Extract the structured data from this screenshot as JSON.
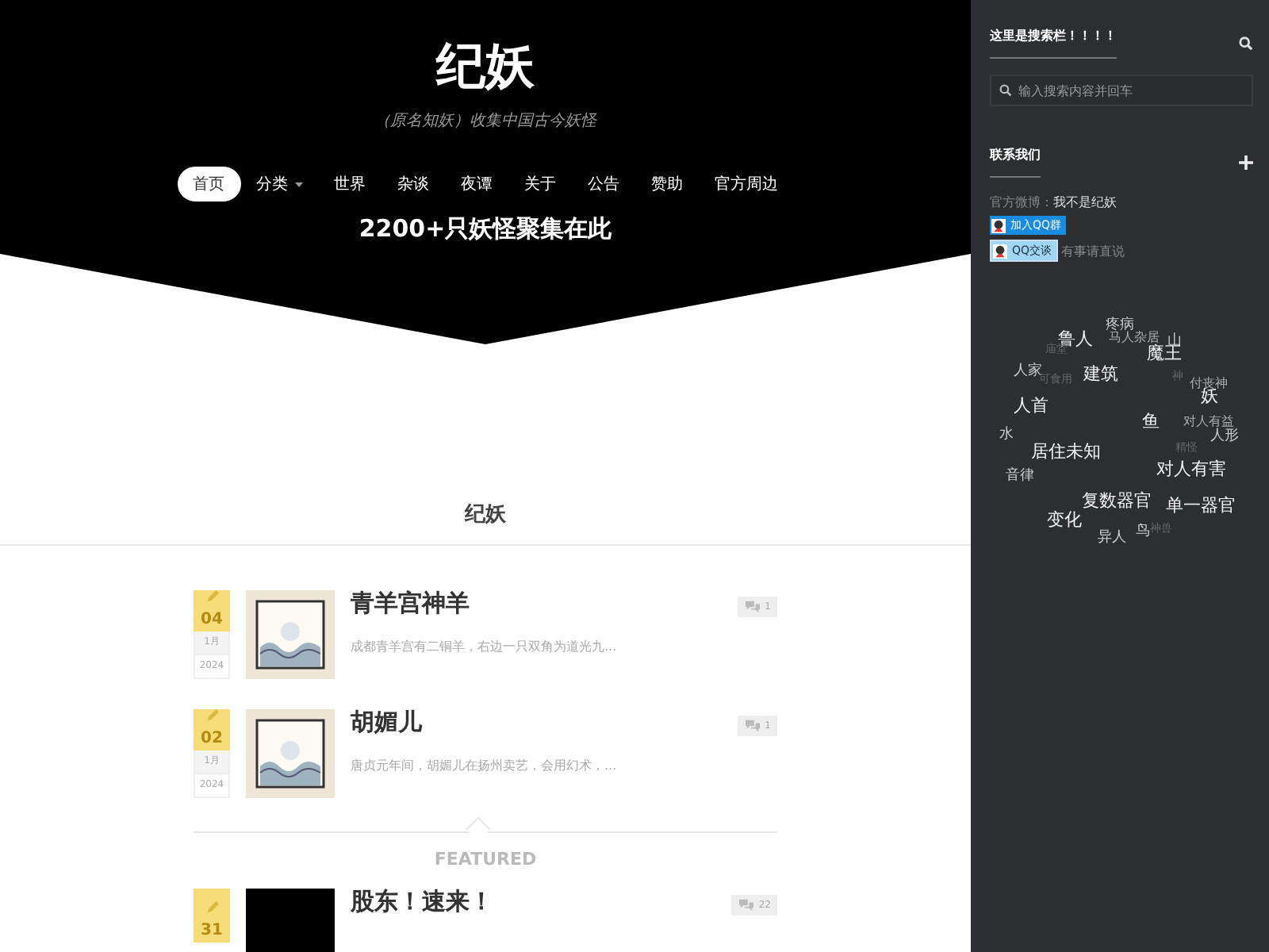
{
  "site": {
    "title": "纪妖",
    "tagline": "（原名知妖）收集中国古今妖怪",
    "banner": "2200+只妖怪聚集在此"
  },
  "nav": [
    {
      "label": "首页",
      "selected": true,
      "dropdown": false
    },
    {
      "label": "分类",
      "selected": false,
      "dropdown": true
    },
    {
      "label": "世界",
      "selected": false,
      "dropdown": false
    },
    {
      "label": "杂谈",
      "selected": false,
      "dropdown": false
    },
    {
      "label": "夜谭",
      "selected": false,
      "dropdown": false
    },
    {
      "label": "关于",
      "selected": false,
      "dropdown": false
    },
    {
      "label": "公告",
      "selected": false,
      "dropdown": false
    },
    {
      "label": "赞助",
      "selected": false,
      "dropdown": false
    },
    {
      "label": "官方周边",
      "selected": false,
      "dropdown": false
    }
  ],
  "section_title": "纪妖",
  "posts": [
    {
      "day": "04",
      "month": "1月",
      "year": "2024",
      "kind": "stamp",
      "title": "青羊宫神羊",
      "excerpt": "成都青羊宫有二铜羊，右边一只双角为道光九...",
      "comments": "1"
    },
    {
      "day": "02",
      "month": "1月",
      "year": "2024",
      "kind": "stamp",
      "title": "胡媚儿",
      "excerpt": "唐贞元年间，胡媚儿在扬州卖艺，会用幻术，...",
      "comments": "1"
    }
  ],
  "featured": {
    "label": "FEATURED",
    "posts": [
      {
        "day": "31",
        "kind": "dark",
        "title": "股东！速来！",
        "comments": "22"
      }
    ]
  },
  "sidebar": {
    "search": {
      "title": "这里是搜索栏！！！！",
      "placeholder": "输入搜索内容并回车"
    },
    "contact": {
      "title": "联系我们",
      "weibo_label": "官方微博：",
      "weibo_link": "我不是纪妖",
      "qq_group": "加入QQ群",
      "qq_chat": "QQ交谈",
      "note": "有事请直说"
    },
    "tags": [
      {
        "label": "鲁人",
        "kind": "big"
      },
      {
        "label": "疼病",
        "kind": "mid"
      },
      {
        "label": "马人杂居",
        "kind": "small"
      },
      {
        "label": "山",
        "kind": "mid"
      },
      {
        "label": "庙堂",
        "kind": "faint"
      },
      {
        "label": "魔王",
        "kind": "big"
      },
      {
        "label": "人家",
        "kind": "mid"
      },
      {
        "label": "可食用",
        "kind": "faint"
      },
      {
        "label": "建筑",
        "kind": "big"
      },
      {
        "label": "神",
        "kind": "faint"
      },
      {
        "label": "付丧神",
        "kind": "small"
      },
      {
        "label": "人首",
        "kind": "big"
      },
      {
        "label": "妖",
        "kind": "big"
      },
      {
        "label": "鱼",
        "kind": "big"
      },
      {
        "label": "对人有益",
        "kind": "small"
      },
      {
        "label": "水",
        "kind": "mid"
      },
      {
        "label": "人形",
        "kind": "mid"
      },
      {
        "label": "居住未知",
        "kind": "big"
      },
      {
        "label": "精怪",
        "kind": "faint"
      },
      {
        "label": "音律",
        "kind": "mid"
      },
      {
        "label": "对人有害",
        "kind": "big"
      },
      {
        "label": "复数器官",
        "kind": "big"
      },
      {
        "label": "单一器官",
        "kind": "big"
      },
      {
        "label": "变化",
        "kind": "big"
      },
      {
        "label": "异人",
        "kind": "mid"
      },
      {
        "label": "鸟",
        "kind": "mid"
      },
      {
        "label": "神兽",
        "kind": "faint"
      }
    ]
  }
}
